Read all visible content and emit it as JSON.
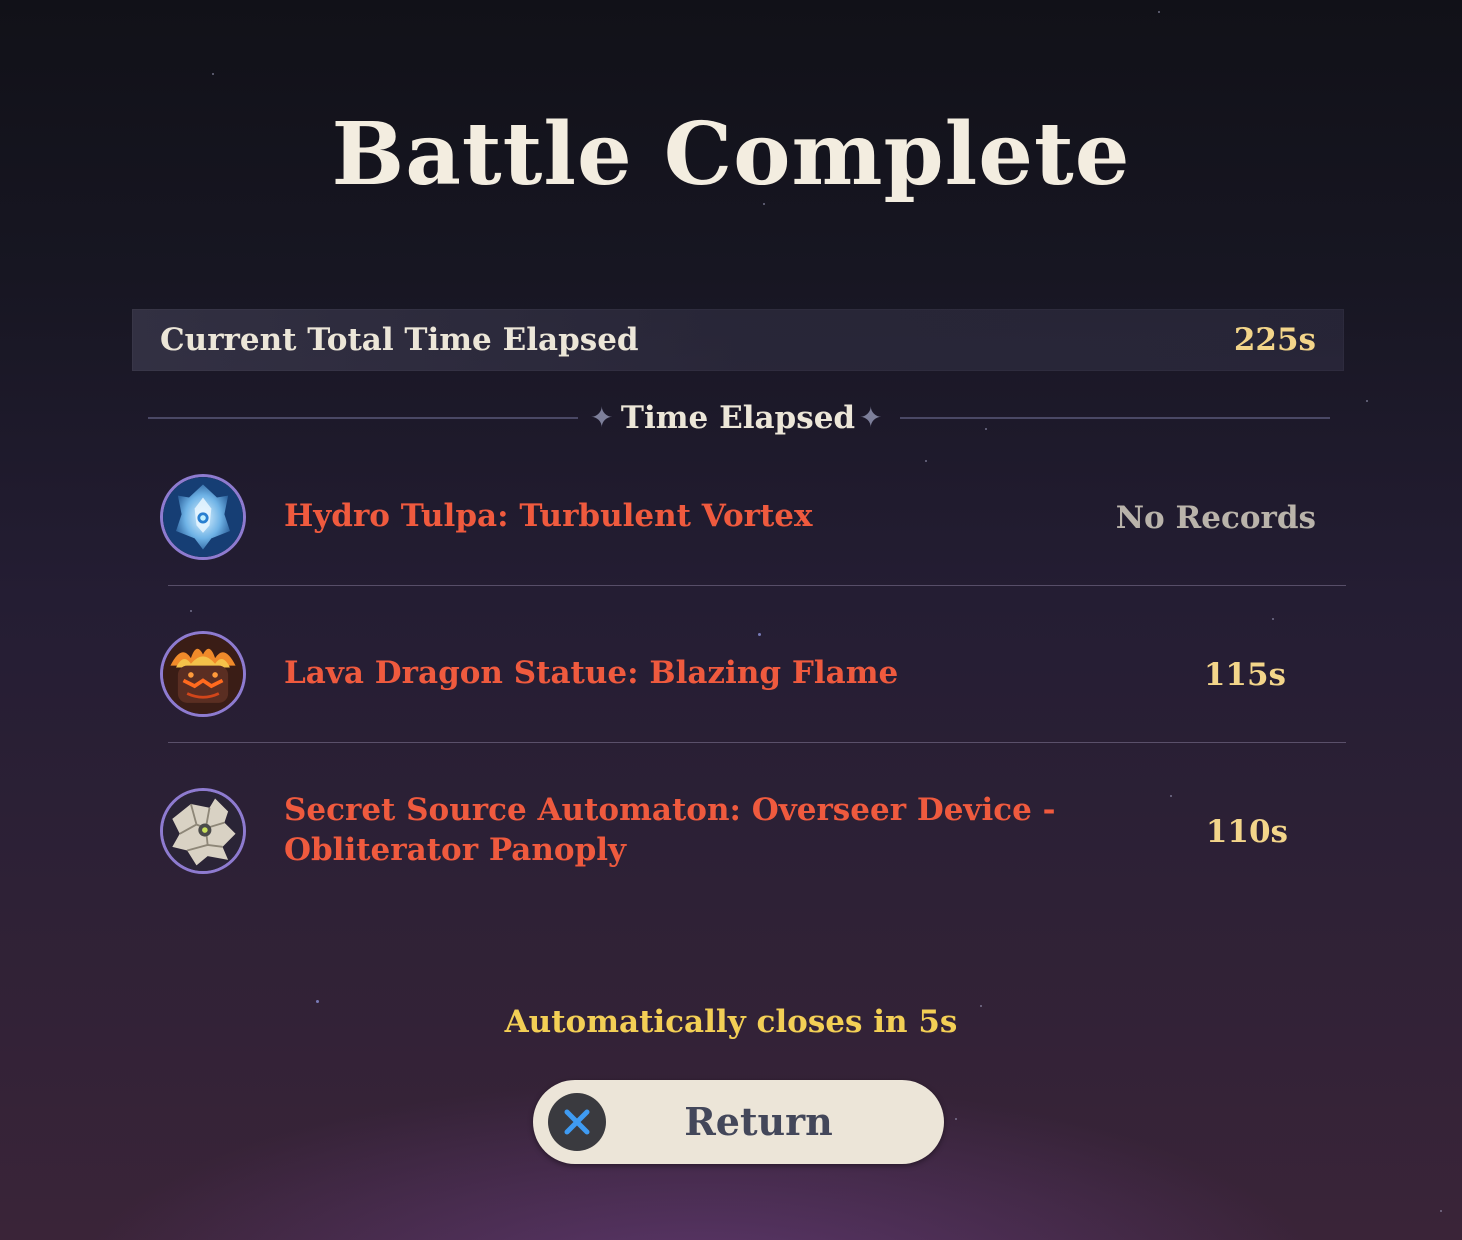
{
  "title": "Battle Complete",
  "total": {
    "label": "Current Total Time Elapsed",
    "value": "225s"
  },
  "section_title": "Time Elapsed",
  "bosses": [
    {
      "name": "Hydro Tulpa: Turbulent Vortex",
      "time": "No Records",
      "icon": "hydro-tulpa-icon"
    },
    {
      "name": "Lava Dragon Statue: Blazing Flame",
      "time": "115s",
      "icon": "lava-dragon-statue-icon"
    },
    {
      "name_line1": "Secret Source Automaton: Overseer Device -",
      "name_line2": "Obliterator Panoply",
      "time": "110s",
      "icon": "secret-source-automaton-icon"
    }
  ],
  "auto_close": "Automatically closes in 5s",
  "return_button": {
    "label": "Return",
    "icon": "x-button-icon"
  },
  "colors": {
    "boss_name": "#ef5a3e",
    "time_value": "#f3d58a",
    "no_record": "#b9b3aa",
    "auto_close": "#f3cf55",
    "button_bg": "#ece5d8"
  }
}
